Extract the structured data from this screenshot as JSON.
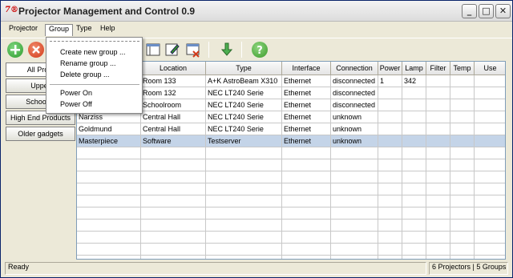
{
  "window": {
    "title": "Projector Management and Control 0.9",
    "icon_text": "7®"
  },
  "menu": [
    "Projector",
    "Group",
    "Type",
    "Help"
  ],
  "group_menu": {
    "items": [
      {
        "label": "Create new group ..."
      },
      {
        "label": "Rename group ..."
      },
      {
        "label": "Delete group ..."
      },
      {
        "label": "Power On"
      },
      {
        "label": "Power Off"
      }
    ]
  },
  "sidebar": [
    "All Proje",
    "Upper",
    "School C",
    "High End Products",
    "Older gadgets"
  ],
  "table": {
    "columns": [
      "",
      "Location",
      "Type",
      "Interface",
      "Connection",
      "Power",
      "Lamp",
      "Filter",
      "Temp",
      "Use"
    ],
    "rows": [
      [
        "",
        "Room 133",
        "A+K AstroBeam X310",
        "Ethernet",
        "disconnected",
        "1",
        "342",
        "",
        "",
        ""
      ],
      [
        "",
        "Room 132",
        "NEC LT240 Serie",
        "Ethernet",
        "disconnected",
        "",
        "",
        "",
        "",
        ""
      ],
      [
        "",
        "Schoolroom",
        "NEC LT240 Serie",
        "Ethernet",
        "disconnected",
        "",
        "",
        "",
        "",
        ""
      ],
      [
        "Narziss",
        "Central Hall",
        "NEC LT240 Serie",
        "Ethernet",
        "unknown",
        "",
        "",
        "",
        "",
        ""
      ],
      [
        "Goldmund",
        "Central Hall",
        "NEC LT240 Serie",
        "Ethernet",
        "unknown",
        "",
        "",
        "",
        "",
        ""
      ],
      [
        "Masterpiece",
        "Software",
        "Testserver",
        "Ethernet",
        "unknown",
        "",
        "",
        "",
        "",
        ""
      ]
    ],
    "empty_rows": 10,
    "selected_row": 5
  },
  "status": {
    "left": "Ready",
    "right": "6 Projectors | 5 Groups"
  },
  "colors": {
    "selection": "#c4d4e8",
    "add": "#2e9b2e",
    "remove": "#d23a1a",
    "help": "#3a9a2a"
  }
}
